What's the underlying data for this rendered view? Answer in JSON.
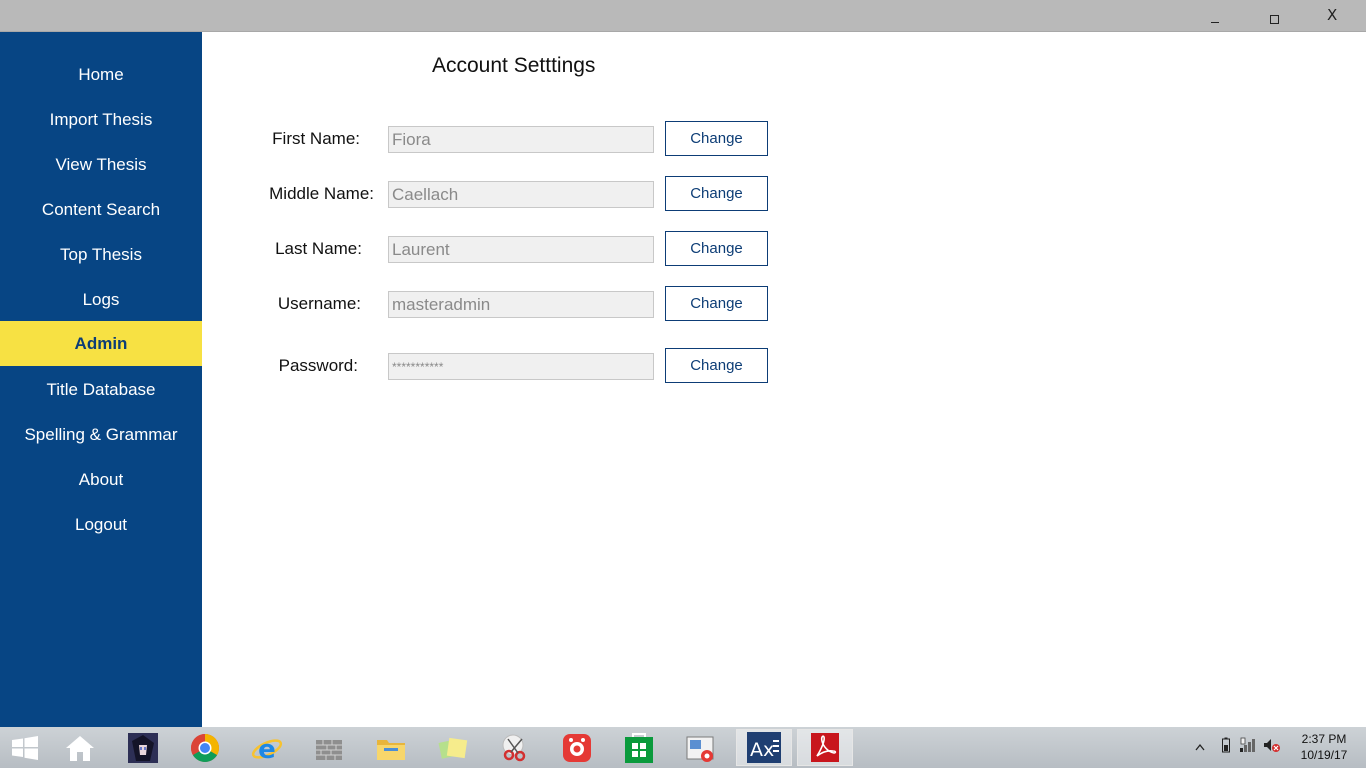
{
  "window": {
    "minimize_glyph": "",
    "maximize_glyph": "",
    "close_glyph": "X"
  },
  "sidebar": {
    "items": [
      {
        "label": "Home"
      },
      {
        "label": "Import Thesis"
      },
      {
        "label": "View Thesis"
      },
      {
        "label": "Content Search"
      },
      {
        "label": "Top Thesis"
      },
      {
        "label": "Logs"
      },
      {
        "label": "Admin",
        "active": true
      },
      {
        "label": "Title Database"
      },
      {
        "label": "Spelling & Grammar"
      },
      {
        "label": "About"
      },
      {
        "label": "Logout"
      }
    ]
  },
  "main": {
    "title": "Account Setttings",
    "rows": [
      {
        "label": "First Name:",
        "value": "Fiora",
        "button": "Change"
      },
      {
        "label": "Middle Name:",
        "value": "Caellach",
        "button": "Change"
      },
      {
        "label": "Last Name:",
        "value": "Laurent",
        "button": "Change"
      },
      {
        "label": "Username:",
        "value": "masteradmin",
        "button": "Change"
      },
      {
        "label": "Password:",
        "value": "***********",
        "button": "Change"
      }
    ]
  },
  "taskbar": {
    "icons": [
      "windows-start-icon",
      "home-icon",
      "anime-avatar-icon",
      "chrome-icon",
      "internet-explorer-icon",
      "firewall-icon",
      "file-explorer-icon",
      "sticky-notes-icon",
      "snipping-tool-icon",
      "screen-recorder-icon",
      "store-icon",
      "media-player-icon",
      "ax-app-icon",
      "acrobat-icon"
    ],
    "clock_time": "2:37 PM",
    "clock_date": "10/19/17",
    "colors": {
      "sidebar": "#074584",
      "active": "#f7e143",
      "accent": "#0d3d76"
    }
  }
}
